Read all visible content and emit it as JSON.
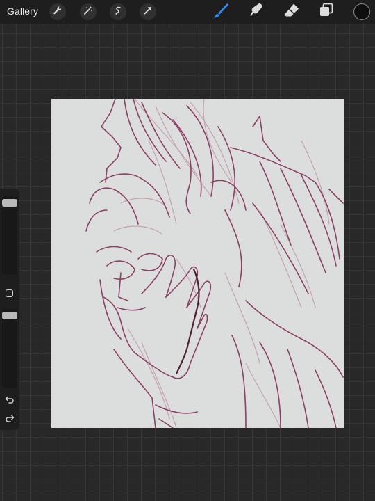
{
  "topbar": {
    "gallery_label": "Gallery",
    "left_tools": [
      "wrench-icon",
      "magic-wand-icon",
      "selection-icon",
      "transform-arrow-icon"
    ],
    "right_tools": [
      "brush-icon",
      "smudge-icon",
      "eraser-icon",
      "layers-icon"
    ],
    "active_tool": "brush",
    "accent_color": "#2f8cf2",
    "current_color": "#0e0e0e"
  },
  "sidebar": {
    "brush_size_level": 0.95,
    "opacity_level": 0.95,
    "icons": [
      "modify-square-icon",
      "undo-icon",
      "redo-icon"
    ]
  },
  "canvas": {
    "background_color": "#dcdedd",
    "sketch_colors": [
      "#8b4065",
      "#c4a2b3",
      "#4e2136"
    ]
  }
}
